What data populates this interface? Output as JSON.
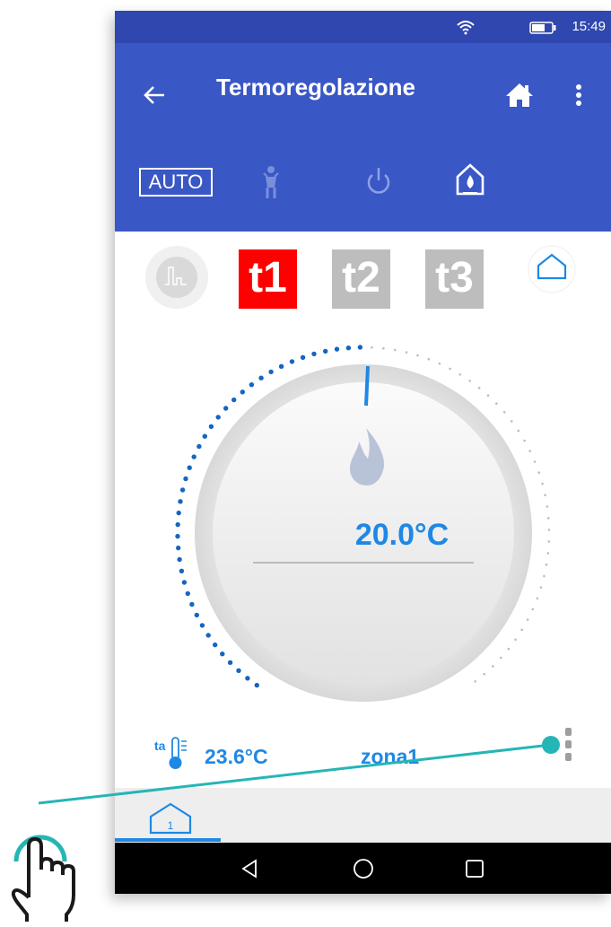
{
  "status_bar": {
    "time": "15:49"
  },
  "app_bar": {
    "title": "Termoregolazione"
  },
  "modes": {
    "auto_label": "AUTO"
  },
  "temperature_levels": [
    {
      "label": "t1",
      "color": "#ff0000",
      "selected": true
    },
    {
      "label": "t2",
      "color": "#bdbdbd",
      "selected": false
    },
    {
      "label": "t3",
      "color": "#bdbdbd",
      "selected": false
    }
  ],
  "dial": {
    "setpoint": "20.0°C",
    "active_color": "#1565c0",
    "indicator_color": "#1e88e5",
    "flame_icon": "flame-icon"
  },
  "ambient": {
    "icon_label": "ta",
    "value": "23.6°C"
  },
  "zone": {
    "name": "zona1"
  },
  "bottom_tab": {
    "number": "1"
  },
  "colors": {
    "accent": "#1e88e5",
    "appbar": "#3a57c6",
    "statusbar": "#2f47ae",
    "teal": "#26b5b5"
  }
}
